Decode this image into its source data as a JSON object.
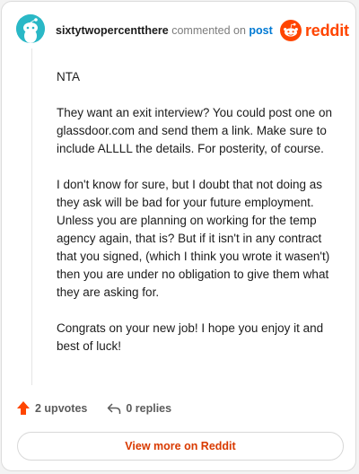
{
  "comment": {
    "username": "sixtytwopercentthere",
    "action_text": "commented on",
    "post_link": "post",
    "paragraphs": [
      "NTA",
      "They want an exit interview? You could post one on glassdoor.com and send them a link. Make sure to include ALLLL the details. For posterity, of course.",
      "I don't know for sure, but I doubt that not doing as they ask will be bad for your future employment. Unless you are planning on working for the temp agency again, that is? But if it isn't in any contract that you signed, (which I think you wrote it wasen't) then you are under no obligation to give them what they are asking for.",
      "Congrats on your new job! I hope you enjoy it and best of luck!"
    ]
  },
  "brand": {
    "name": "reddit",
    "color": "#ff4500"
  },
  "actions": {
    "upvotes": "2 upvotes",
    "replies": "0 replies"
  },
  "footer": {
    "view_more_label": "View more on Reddit"
  },
  "icons": {
    "avatar": "snoo-avatar-icon",
    "logo": "reddit-snoo-icon",
    "upvote": "upvote-arrow-icon",
    "reply": "reply-arrow-icon"
  }
}
